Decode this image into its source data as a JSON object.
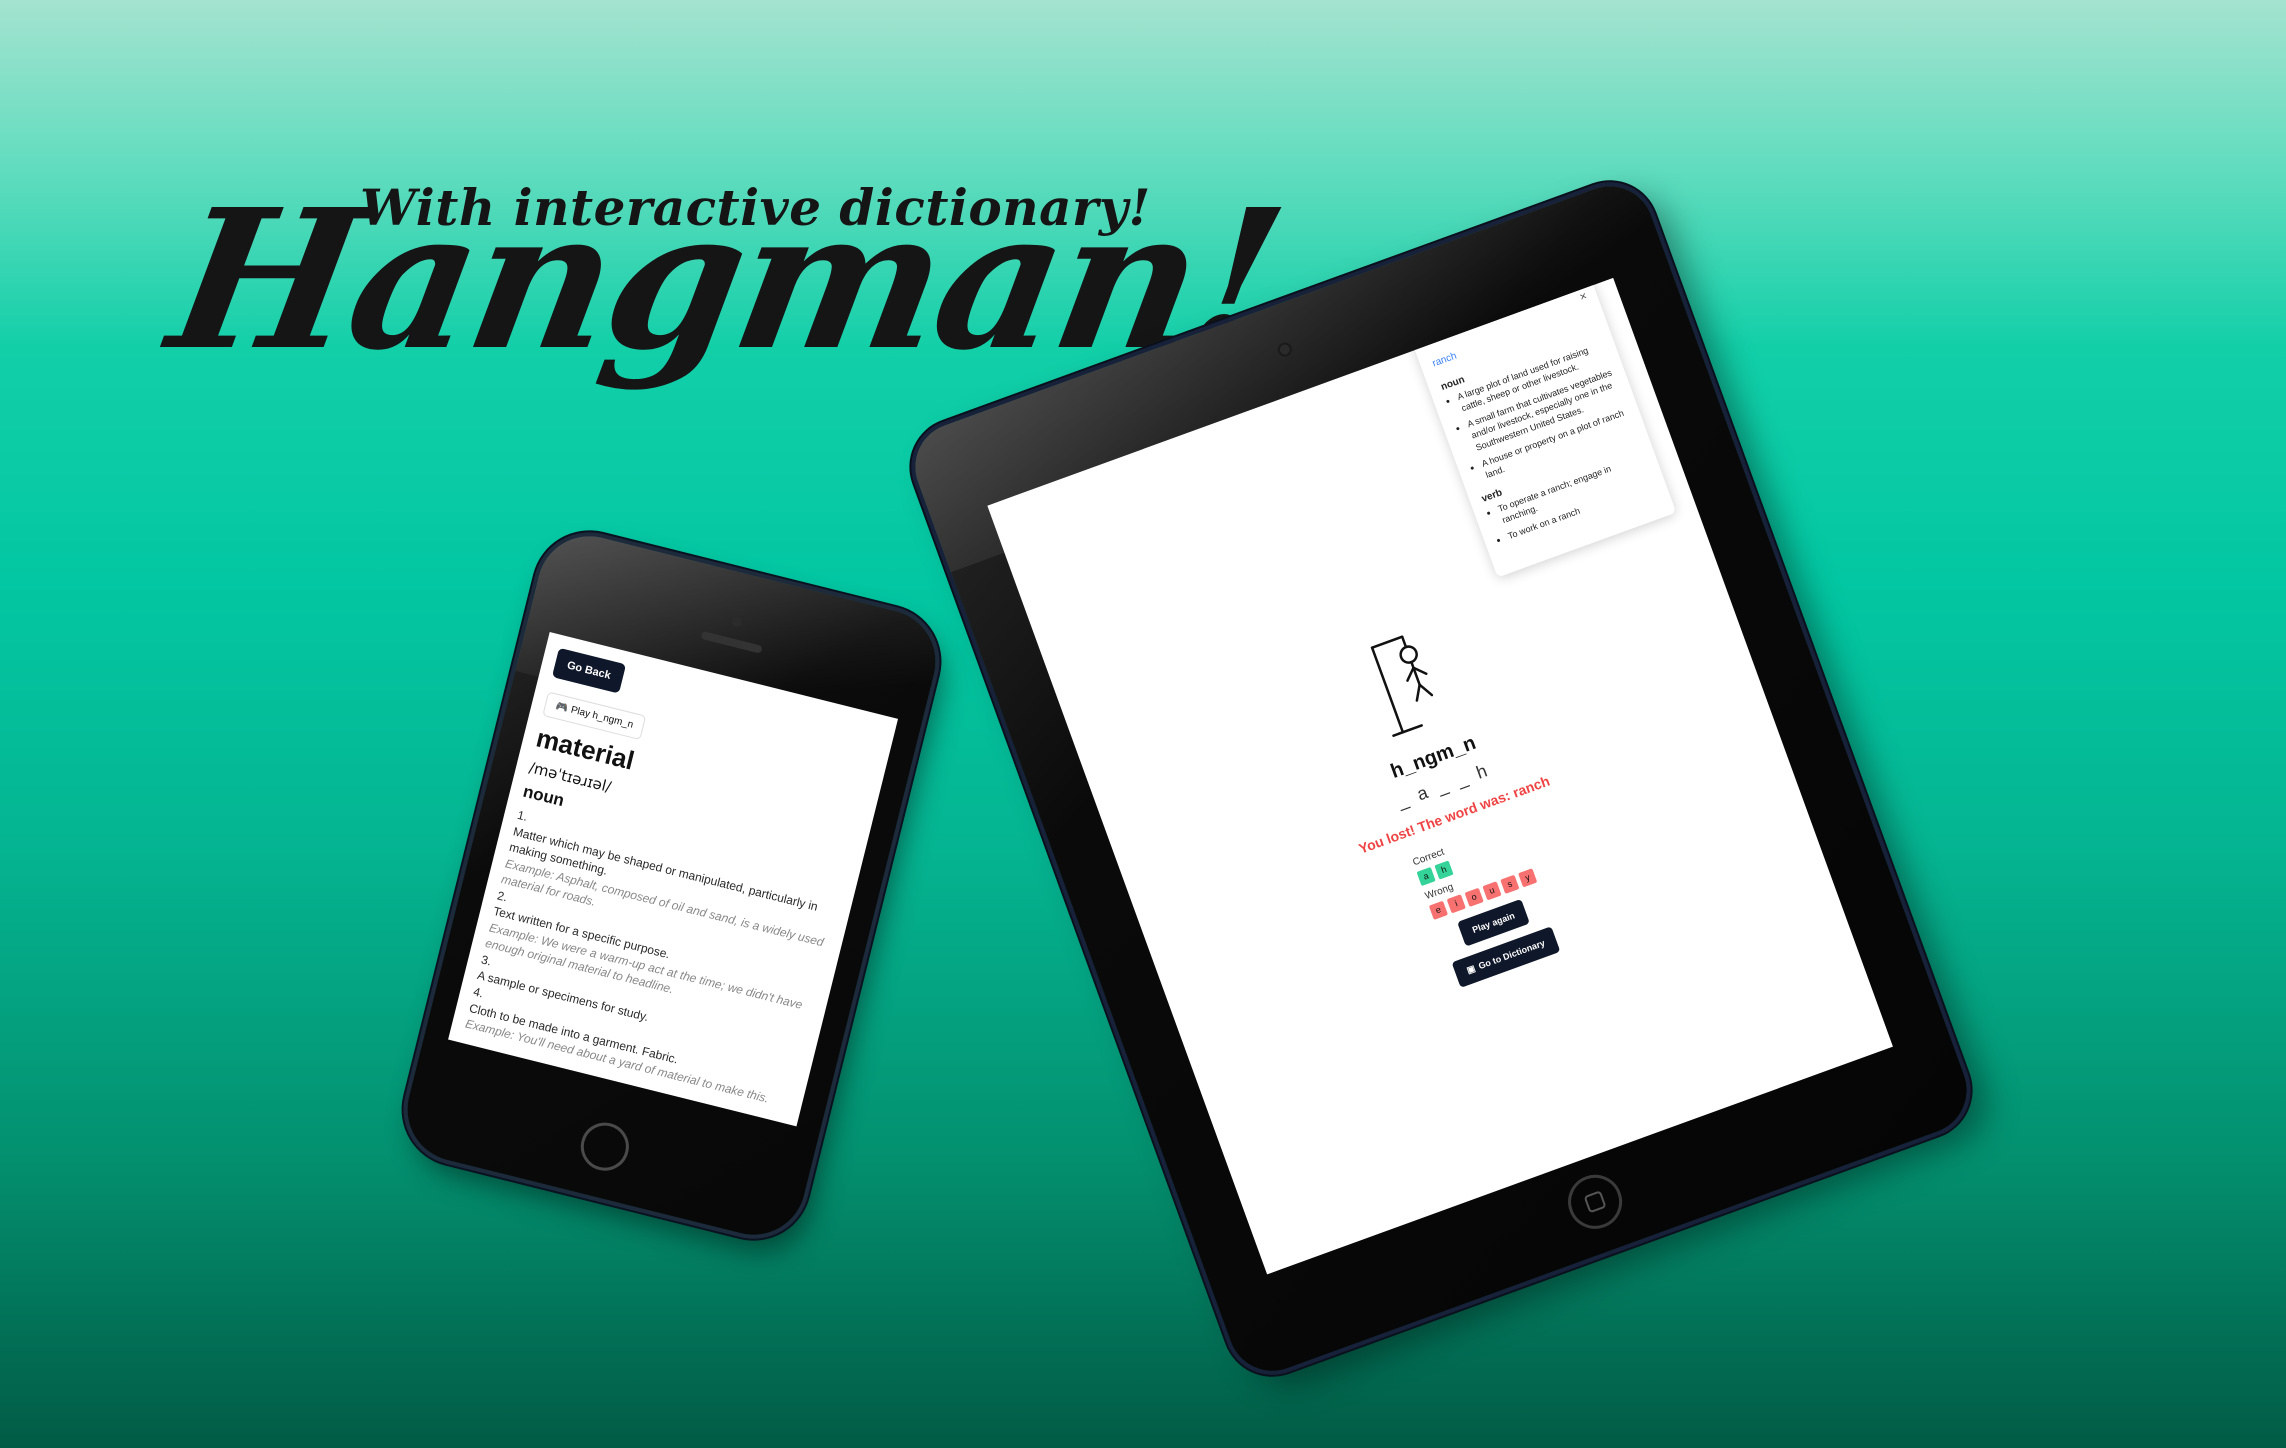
{
  "heading": {
    "subtitle": "With interactive dictionary!",
    "title": "Hangman!"
  },
  "phone": {
    "back_label": "Go Back",
    "play_icon": "gamepad-icon",
    "play_label": "Play h_ngm_n",
    "word": "material",
    "phonetic": "/məˈtɪəɹɪəl/",
    "part_of_speech": "noun",
    "definitions": [
      {
        "num": "1.",
        "text": "Matter which may be shaped or manipulated, particularly in making something.",
        "example": "Example: Asphalt, composed of oil and sand, is a widely used material for roads."
      },
      {
        "num": "2.",
        "text": "Text written for a specific purpose.",
        "example": "Example: We were a warm-up act at the time; we didn't have enough original material to headline."
      },
      {
        "num": "3.",
        "text": "A sample or specimens for study.",
        "example": ""
      },
      {
        "num": "4.",
        "text": "Cloth to be made into a garment. Fabric.",
        "example": "Example: You'll need about a yard of material to make this."
      }
    ]
  },
  "tablet": {
    "popup": {
      "close": "×",
      "word": "ranch",
      "noun_label": "noun",
      "noun_defs": [
        "A large plot of land used for raising cattle, sheep or other livestock.",
        "A small farm that cultivates vegetables and/or livestock, especially one in the Southwestern United States.",
        "A house or property on a plot of ranch land."
      ],
      "verb_label": "verb",
      "verb_defs": [
        "To operate a ranch; engage in ranching.",
        "To work on a ranch"
      ]
    },
    "masked_title": "h_ngm_n",
    "guess": "_ a _ _ h",
    "lost_message": "You lost! The word was: ranch",
    "correct_label": "Correct",
    "correct_letters": [
      "a",
      "h"
    ],
    "wrong_label": "Wrong",
    "wrong_letters": [
      "e",
      "i",
      "o",
      "u",
      "s",
      "y"
    ],
    "play_again": "Play again",
    "dictionary_icon": "book-icon",
    "go_dictionary": "Go to Dictionary"
  },
  "colors": {
    "accent_blue": "#3b82f6",
    "dark_button": "#0f172a",
    "error_red": "#ef4444",
    "correct_green": "#34d399",
    "wrong_red": "#f87171"
  }
}
